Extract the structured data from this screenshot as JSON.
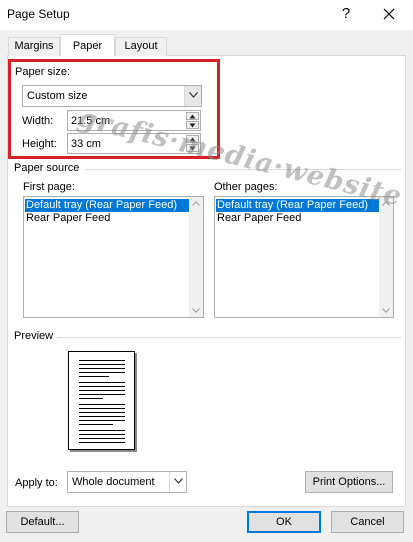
{
  "window": {
    "title": "Page Setup",
    "help_label": "?"
  },
  "tabs": [
    {
      "label": "Margins"
    },
    {
      "label": "Paper"
    },
    {
      "label": "Layout"
    }
  ],
  "paper_size": {
    "label": "Paper size:",
    "selected": "Custom size",
    "width_label": "Width:",
    "width_value": "21.5 cm",
    "height_label": "Height:",
    "height_value": "33 cm"
  },
  "paper_source": {
    "label": "Paper source",
    "first_page_label": "First page:",
    "first_page_items": [
      "Default tray (Rear Paper Feed)",
      "Rear Paper Feed"
    ],
    "other_pages_label": "Other pages:",
    "other_pages_items": [
      "Default tray (Rear Paper Feed)",
      "Rear Paper Feed"
    ]
  },
  "preview": {
    "label": "Preview"
  },
  "apply_to": {
    "label": "Apply to:",
    "selected": "Whole document"
  },
  "buttons": {
    "print_options": "Print Options...",
    "default": "Default...",
    "ok": "OK",
    "cancel": "Cancel"
  },
  "watermark": "grafis·media·website",
  "colors": {
    "accent": "#0078d7",
    "highlight_box": "#d61f26"
  }
}
